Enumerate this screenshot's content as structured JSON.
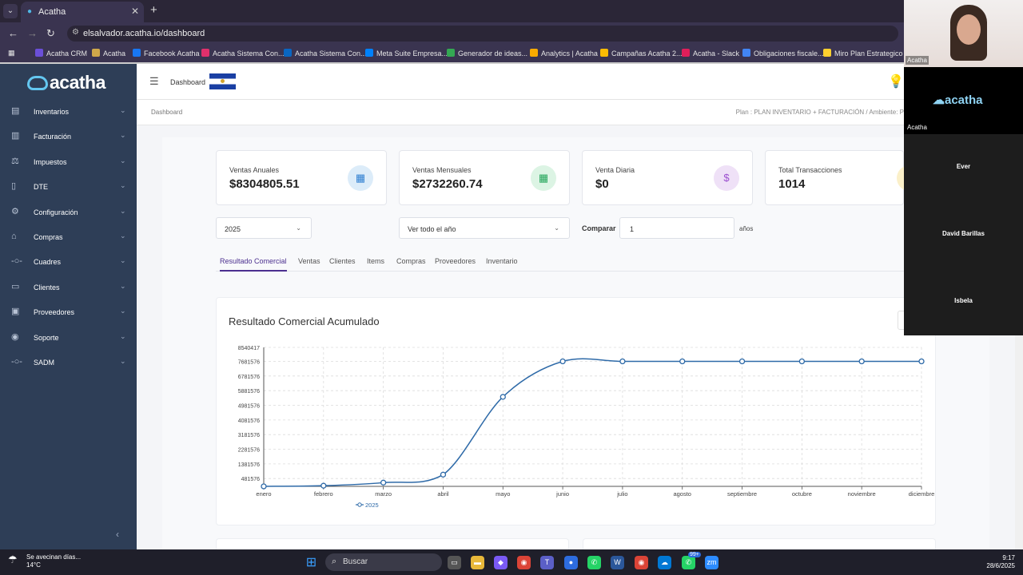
{
  "browser": {
    "tab_title": "Acatha",
    "url": "elsalvador.acatha.io/dashboard",
    "bookmarks": [
      {
        "label": "Acatha CRM",
        "color": "#6b4fd8"
      },
      {
        "label": "Acatha",
        "color": "#cfa84a"
      },
      {
        "label": "Facebook Acatha",
        "color": "#1877f2"
      },
      {
        "label": "Acatha Sistema Con...",
        "color": "#e1306c"
      },
      {
        "label": "Acatha Sistema Con...",
        "color": "#0a66c2"
      },
      {
        "label": "Meta Suite Empresa...",
        "color": "#0081fb"
      },
      {
        "label": "Generador de ideas...",
        "color": "#34a853"
      },
      {
        "label": "Analytics | Acatha",
        "color": "#f9ab00"
      },
      {
        "label": "Campañas Acatha 2...",
        "color": "#fbbc04"
      },
      {
        "label": "Acatha - Slack",
        "color": "#e01e5a"
      },
      {
        "label": "Obligaciones fiscale...",
        "color": "#4285f4"
      },
      {
        "label": "Miro Plan Estrategico",
        "color": "#ffd02f"
      }
    ]
  },
  "app": {
    "brand": "acatha",
    "header_title": "Dashboard",
    "breadcrumb": "Dashboard",
    "plan_text": "Plan : PLAN INVENTARIO + FACTURACIÓN / Ambiente: P"
  },
  "sidebar": {
    "items": [
      {
        "label": "Inventarios",
        "icon": "inventory-icon"
      },
      {
        "label": "Facturación",
        "icon": "invoice-icon"
      },
      {
        "label": "Impuestos",
        "icon": "tax-icon"
      },
      {
        "label": "DTE",
        "icon": "dte-icon"
      },
      {
        "label": "Configuración",
        "icon": "settings-icon"
      },
      {
        "label": "Compras",
        "icon": "purchases-icon"
      },
      {
        "label": "Cuadres",
        "icon": "balance-icon"
      },
      {
        "label": "Clientes",
        "icon": "clients-icon"
      },
      {
        "label": "Proveedores",
        "icon": "suppliers-icon"
      },
      {
        "label": "Soporte",
        "icon": "support-icon"
      },
      {
        "label": "SADM",
        "icon": "sadm-icon"
      }
    ]
  },
  "kpis": [
    {
      "label": "Ventas Anuales",
      "value": "$8304805.51",
      "icon": "calendar-icon",
      "color": "#2f7fd1",
      "bg": "#dcecf9"
    },
    {
      "label": "Ventas Mensuales",
      "value": "$2732260.74",
      "icon": "calendar-icon",
      "color": "#23a55a",
      "bg": "#dcf4e4"
    },
    {
      "label": "Venta Diaria",
      "value": "$0",
      "icon": "dollar-icon",
      "color": "#9b4fcf",
      "bg": "#efe1f7"
    },
    {
      "label": "Total Transacciones",
      "value": "1014",
      "icon": "receipt-icon",
      "color": "#d4a52e",
      "bg": "#fbf0c9"
    }
  ],
  "filters": {
    "year": "2025",
    "period": "Ver todo el año",
    "compare_label": "Comparar",
    "compare_value": "1",
    "compare_unit": "años"
  },
  "tabs": [
    "Resultado Comercial",
    "Ventas",
    "Clientes",
    "Items",
    "Compras",
    "Proveedores",
    "Inventario"
  ],
  "chart_title": "Resultado Comercial Acumulado",
  "chart_data": {
    "type": "line",
    "title": "Resultado Comercial Acumulado",
    "categories": [
      "enero",
      "febrero",
      "marzo",
      "abril",
      "mayo",
      "junio",
      "julio",
      "agosto",
      "septiembre",
      "octubre",
      "noviembre",
      "diciembre"
    ],
    "y_ticks": [
      "8540417",
      "7681576",
      "6781576",
      "5881576",
      "4981576",
      "4081576",
      "3181576",
      "2281576",
      "1381576",
      "481576"
    ],
    "ylim": [
      0,
      8540417
    ],
    "series": [
      {
        "name": "2025",
        "color": "#2e6aa8",
        "values": [
          0,
          40000,
          230000,
          720000,
          5500000,
          7681576,
          7681576,
          7681576,
          7681576,
          7681576,
          7681576,
          7681576
        ]
      }
    ],
    "grid": true,
    "legend": "bottom"
  },
  "video": {
    "participants": [
      {
        "name": "Acatha",
        "kind": "camera"
      },
      {
        "name": "Acatha",
        "kind": "logo"
      },
      {
        "name": "Ever",
        "kind": "tile"
      },
      {
        "name": "David Barillas",
        "kind": "tile"
      },
      {
        "name": "Isbela",
        "kind": "tile"
      }
    ]
  },
  "taskbar": {
    "weather_line1": "Se avecinan días...",
    "weather_line2": "14°C",
    "search": "Buscar",
    "time": "9:17",
    "date": "28/6/2025",
    "whatsapp_badge": "99+"
  }
}
